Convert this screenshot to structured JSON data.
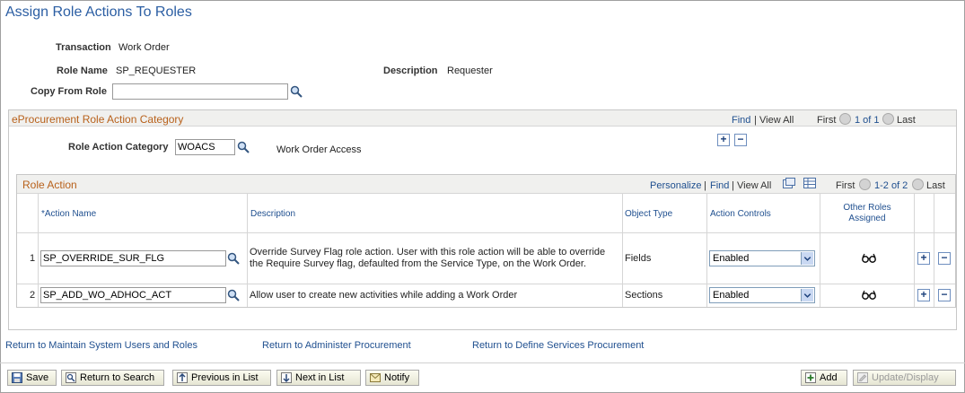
{
  "page": {
    "title": "Assign Role Actions To Roles"
  },
  "header": {
    "transaction_label": "Transaction",
    "transaction_value": "Work Order",
    "role_name_label": "Role Name",
    "role_name_value": "SP_REQUESTER",
    "description_label": "Description",
    "description_value": "Requester",
    "copy_from_label": "Copy From Role",
    "copy_from_value": ""
  },
  "category_group": {
    "title": "eProcurement Role Action Category",
    "find": "Find",
    "view_all": "View All",
    "first": "First",
    "range": "1 of 1",
    "last": "Last",
    "field_label": "Role Action Category",
    "field_value": "WOACS",
    "field_desc": "Work Order Access"
  },
  "role_action_grid": {
    "title": "Role Action",
    "personalize": "Personalize",
    "find": "Find",
    "view_all": "View All",
    "first": "First",
    "range": "1-2 of 2",
    "last": "Last",
    "columns": {
      "action_name": "*Action Name",
      "description": "Description",
      "object_type": "Object Type",
      "action_controls": "Action Controls",
      "other_roles": "Other Roles Assigned"
    },
    "rows": [
      {
        "num": "1",
        "action_name": "SP_OVERRIDE_SUR_FLG",
        "description": "Override Survey Flag role action. User with this role action will be able to override the Require Survey flag, defaulted from the Service Type, on the Work Order.",
        "object_type": "Fields",
        "action_control": "Enabled"
      },
      {
        "num": "2",
        "action_name": "SP_ADD_WO_ADHOC_ACT",
        "description": "Allow user to create new activities while adding a Work Order",
        "object_type": "Sections",
        "action_control": "Enabled"
      }
    ]
  },
  "links": {
    "maintain_users": "Return to Maintain System Users and Roles",
    "administer_procurement": "Return to Administer Procurement",
    "define_services": "Return to Define Services Procurement"
  },
  "toolbar": {
    "save": "Save",
    "return_to_search": "Return to Search",
    "previous_in_list": "Previous in List",
    "next_in_list": "Next in List",
    "notify": "Notify",
    "add": "Add",
    "update_display": "Update/Display"
  }
}
